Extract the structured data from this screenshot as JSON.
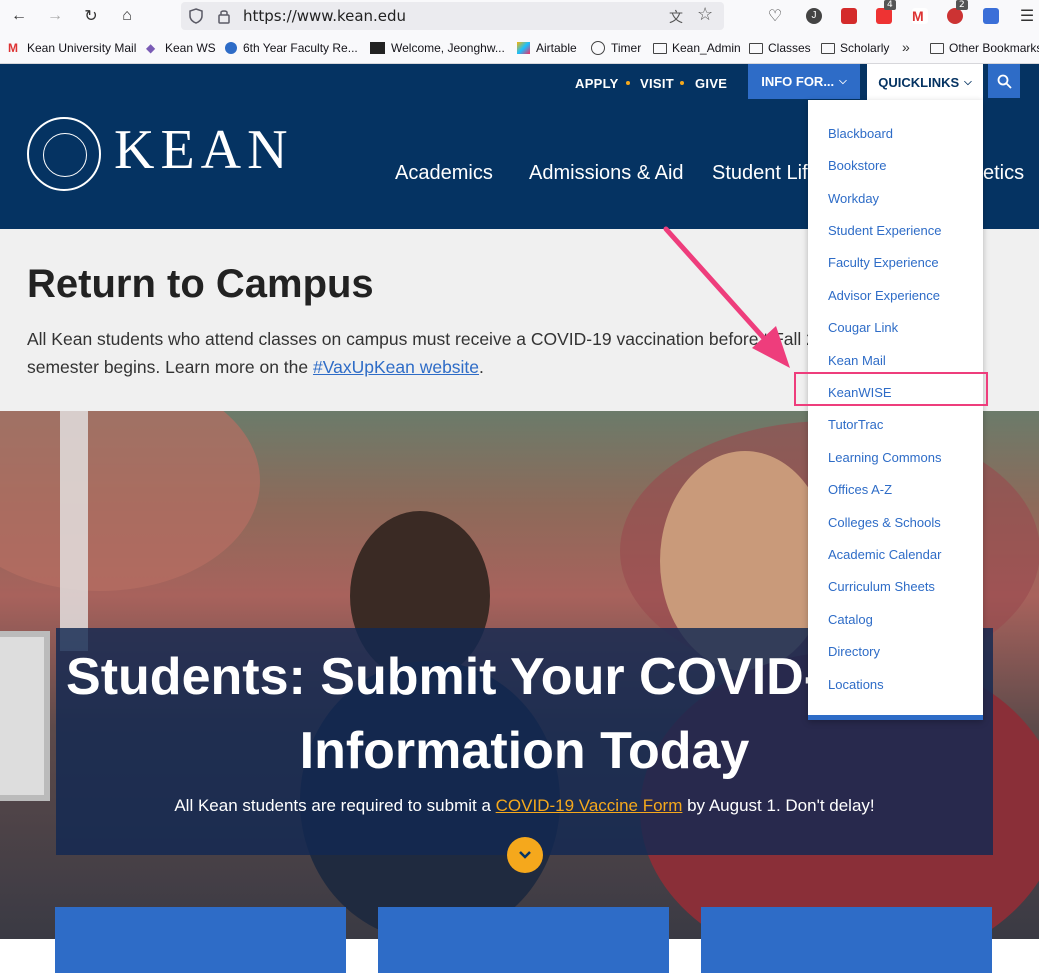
{
  "browser": {
    "url": "https://www.kean.edu",
    "extension_badges": [
      "4",
      "2"
    ]
  },
  "bookmarks": [
    {
      "label": "Kean University Mail",
      "icon": "gmail-icon"
    },
    {
      "label": "Kean WS",
      "icon": "diamond-icon"
    },
    {
      "label": "6th Year Faculty Re...",
      "icon": "info-icon"
    },
    {
      "label": "Welcome, Jeonghw...",
      "icon": "bb-icon"
    },
    {
      "label": "Airtable",
      "icon": "airtable-icon"
    },
    {
      "label": "Timer",
      "icon": "globe-icon"
    },
    {
      "label": "Kean_Admin",
      "icon": "folder-icon"
    },
    {
      "label": "Classes",
      "icon": "folder-icon"
    },
    {
      "label": "Scholarly",
      "icon": "folder-icon"
    },
    {
      "label": "Other Bookmarks",
      "icon": "folder-icon"
    }
  ],
  "header": {
    "utility_links": [
      "APPLY",
      "VISIT",
      "GIVE"
    ],
    "info_for": "INFO FOR...",
    "quicklinks": "QUICKLINKS",
    "logo": "KEAN",
    "nav": [
      "Academics",
      "Admissions & Aid",
      "Student Life",
      "etics"
    ]
  },
  "notice": {
    "title": "Return to Campus",
    "line1": "All Kean students who attend classes on campus must receive a COVID-19 vaccination before t",
    "line1_end": "Fall 2",
    "line2_prefix": "semester begins. Learn more on the ",
    "link": "#VaxUpKean website",
    "line2_suffix": "."
  },
  "hero": {
    "title_line1": "Students: Submit Your COVID-19 Vac",
    "title_line2": "Information Today",
    "sub_prefix": "All Kean students are required to submit a ",
    "sub_link": "COVID-19 Vaccine Form",
    "sub_suffix": " by August 1. Don't delay!"
  },
  "quicklinks_menu": [
    "Blackboard",
    "Bookstore",
    "Workday",
    "Student Experience",
    "Faculty Experience",
    "Advisor Experience",
    "Cougar Link",
    "Kean Mail",
    "KeanWISE",
    "TutorTrac",
    "Learning Commons",
    "Offices A-Z",
    "Colleges & Schools",
    "Academic Calendar",
    "Curriculum Sheets",
    "Catalog",
    "Directory",
    "Locations"
  ],
  "annotation": {
    "highlighted_item": "KeanWISE",
    "arrow_color": "#ee3d7c"
  },
  "colors": {
    "header_bg": "#053362",
    "accent_blue": "#2e6cc7",
    "accent_gold": "#f5a81c"
  }
}
